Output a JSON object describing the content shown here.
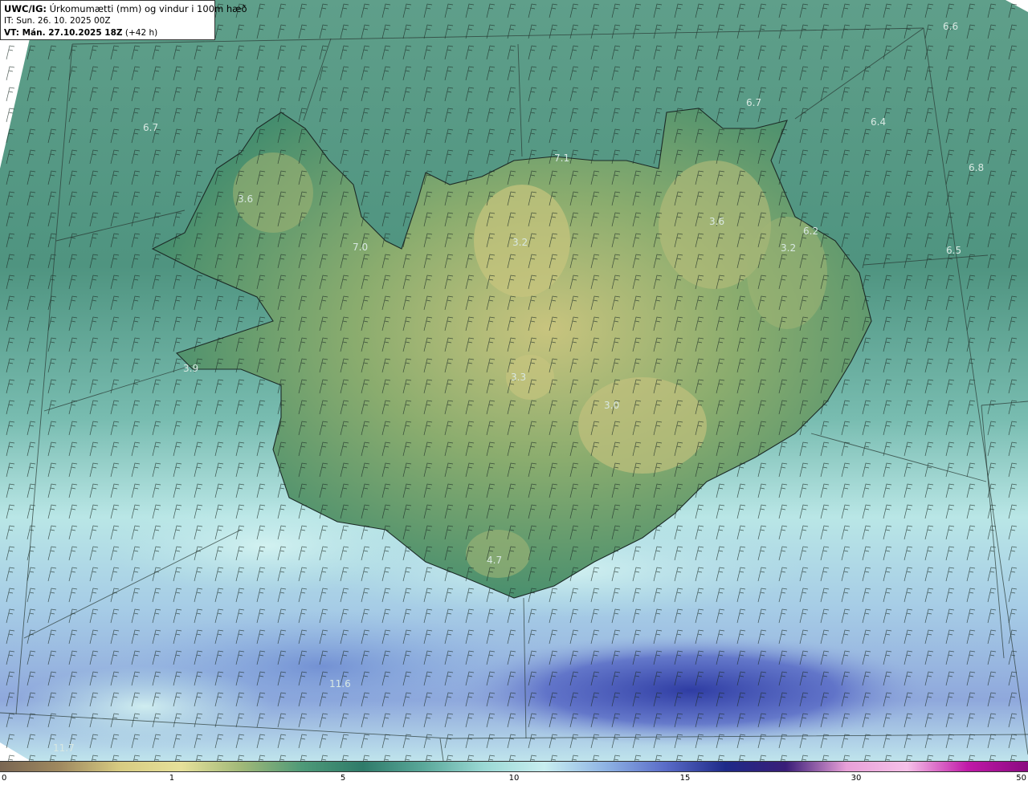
{
  "header": {
    "model_label": "UWC/IG:",
    "title": "Úrkomumætti (mm) og vindur i 100m hæð",
    "it_line": "IT: Sun. 26. 10. 2025 00Z",
    "vt_label": "VT: Mán. 27.10.2025 18Z",
    "vt_offset": "(+42 h)"
  },
  "colorbar": {
    "ticks": [
      {
        "label": "0",
        "pos": 0.0
      },
      {
        "label": "1",
        "pos": 0.1671
      },
      {
        "label": "5",
        "pos": 0.3336
      },
      {
        "label": "10",
        "pos": 0.5
      },
      {
        "label": "15",
        "pos": 0.6664
      },
      {
        "label": "30",
        "pos": 0.8328
      },
      {
        "label": "50",
        "pos": 1.0
      }
    ],
    "colors": [
      "#7a6652",
      "#a08a60",
      "#d8cc82",
      "#e6e09a",
      "#a0b878",
      "#4e9a78",
      "#2f7b6a",
      "#5aa89a",
      "#9ad8d4",
      "#c8eef0",
      "#8fb4e4",
      "#5a6cc8",
      "#1e2a88",
      "#3a1e78",
      "#e8a0d8",
      "#f6c0e8",
      "#c01aa8",
      "#8a0a80"
    ]
  },
  "map_labels": [
    {
      "text": "6.6"
    },
    {
      "text": "6.7"
    },
    {
      "text": "6.7"
    },
    {
      "text": "6.4"
    },
    {
      "text": "6.8"
    },
    {
      "text": "7.1"
    },
    {
      "text": "3.6"
    },
    {
      "text": "3.6"
    },
    {
      "text": "7.0"
    },
    {
      "text": "3.2"
    },
    {
      "text": "6.2"
    },
    {
      "text": "3.2"
    },
    {
      "text": "6.5"
    },
    {
      "text": "3.9"
    },
    {
      "text": "3.3"
    },
    {
      "text": "3.0"
    },
    {
      "text": "4.7"
    },
    {
      "text": "11.6"
    },
    {
      "text": "11.7"
    }
  ]
}
